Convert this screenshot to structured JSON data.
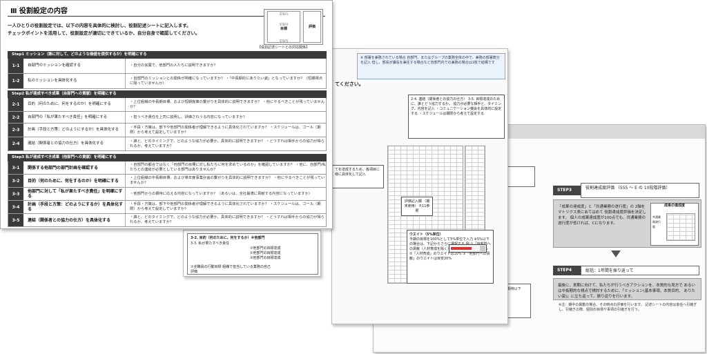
{
  "front": {
    "title": "Ⅲ 役割設定の内容",
    "intro1": "一人ひとりの役割設定では、以下の内容を具体的に検討し、役割記述シートに記入します。",
    "intro2": "チェックポイントを活用して、役割設定が適切にできているか、自分自身で確認してください。",
    "thumb": {
      "top": "STEP1",
      "mid": "目標",
      "step2": "STEP2",
      "right": "評価",
      "bottom": "STEP5"
    },
    "sheet_ref": "【役割記述シートとの対応関係】",
    "steps": [
      {
        "head": "Step1 ミッション（誰に対して、どのような価値を提供するか）を明確にする",
        "rows": [
          {
            "num": "1-1",
            "label": "自部門のミッションを確認する",
            "check": "・自分の言葉で、他部門の人たちに説明できますか？",
            "h": 17
          },
          {
            "num": "1-2",
            "label": "私のミッションを具体化する",
            "check": "・自部門のミッションとの関係が明確になっていますか？ ・「中長期的にありたい姿」となっていますか？（短期視点に陥っていませんか）",
            "h": 19
          }
        ]
      },
      {
        "head": "Step2 私が達成すべき成果（自部門への貢献）を明確にする",
        "rows": [
          {
            "num": "2-1",
            "label": "目的（何のために、何をするのか）を明確にする",
            "check": "・上位組織の中長期目標、および短期施策の繋がりを具体的に説明できますか？ ・他にやるべきことが残っていませんか？",
            "h": 20
          },
          {
            "num": "2-2",
            "label": "自部門の「私が果たすべき責任」を明確にする",
            "check": "・担うべき責任を上司に説明し、評価されうる内容になっていますか？",
            "h": 17
          },
          {
            "num": "2-3",
            "label": "計画（手段と方策：どのようにするか）を具体化する",
            "check": "・手段・方策は、部下や他部門の関係者が理解できるように具体化されていますか？ ・スケジュールは、ゴール（期限）から考えて設定していますか？",
            "h": 20
          },
          {
            "num": "2-4",
            "label": "連結（関係者との協力の仕方）を具体化する",
            "check": "・誰と、どのタイミングで、どのような協力が必要か、具体的に説明できますか？ ・どうすれば相手からの協力が得られるか、考えていますか？",
            "h": 19
          }
        ]
      },
      {
        "head": "Step3 私が達成すべき成果（他部門への貢献）を明確にする",
        "rows": [
          {
            "num": "3-1",
            "label": "関係する他部門の部門計画を確認する",
            "check": "・自部門の都合ではなく「他部門の目標に対し私たちに何を求めているのか」を確認していますか？ ・他に、自部門/私たちとの連結が必要としている部門はありませんか？",
            "h": 19,
            "bold": true
          },
          {
            "num": "3-2",
            "label": "目的（何のために、何をするのか）を明確にする",
            "check": "・上位組織の中長期目標、および単年度事業計画の繋がりを具体的に説明できますか？ ・他にやるべきことが残っていませんか？",
            "h": 19,
            "bold": true
          },
          {
            "num": "3-3",
            "label": "他部門に対して「私が果たすべき責任」を明確にする",
            "check": "・他部門からの期待に応える内容になっていますか？（あるいは、全社最適に貢献する内容になっていますか）",
            "h": 19,
            "bold": true
          },
          {
            "num": "3-4",
            "label": "計画（手段と方策：どのようにするか）を具体化する",
            "check": "・手段・方策は、部下や他部門の関係者が理解できるように具体化されていますか？ ・スケジュールは、ゴール（期限）から考えて設定していますか？",
            "h": 19,
            "bold": true
          },
          {
            "num": "3-5",
            "label": "連結（関係者との協力の仕方）を具体化する",
            "check": "・誰と、どのタイミングで、どのような協力が必要か、具体的に説明できますか？ ・どうすれば相手からの協力が得られるか、考えていますか？",
            "h": 19,
            "bold": true
          }
        ]
      }
    ]
  },
  "mid": {
    "bluebox": "※ 部署を兼務されている場合 自部門、またはグループの業務全体の中で、兼務の部署数分を記入 但し、部長が課長を兼任する場合など自部門内での兼務の場合は1枚で結構です",
    "headline": "てください。",
    "callout_top": "2-4. 連結（関係者との協力の仕方） 3-5. 目標達成のために、誰とどう協力するか。 協力が必要な相手と、タイミング、内容を記入 ・コミュニケーション機会を具体的に設定する ・スケジュールは期限から考えて設定する",
    "callout_left": "てを達成するため、各項目に 様に具体化して記入",
    "callout_mid": "評価記入欄 （期末使用） P.11参照",
    "weight_title": "ウエイト（5%単位）",
    "weight_body": "今期の目標を100%として5%単位で入力 ※5%以下の場合は、下記からさらに選択する 例 ①「自部門への貢献（人材育成を除く）」のウエイトは目安70% ②「人材育成」のウエイトは10% ③「他部門への貢献」のウエイトは目安20%"
  },
  "left": {
    "row1": "3-2. 目的（何のために、何をするか）※他部門",
    "row2": "3-3. 私が果たすべき責任",
    "opts": [
      "①他部門の目標達成",
      "②他部門の目標達成",
      "③他部門の目標達成"
    ],
    "foot": "①全職員の行動目標 組織で担当している業務の自己評価"
  },
  "right": {
    "step3_label": "STEP3",
    "step3_desc": "役割達成度評価 （555 ～ E の 10段階評価）",
    "step3_box": "「成果の達成度」と「共通業務の遂行度」の 2軸をマトリクス表にあてはめて 役割達成度評価を決定します。 個人の成果達成度が100点でも、共通業務の 遂行度が低ければ、Cになります。",
    "matrix_title": "成果の達成度",
    "matrix_axis": "共通業務遂行度",
    "step4_label": "STEP4",
    "step4_desc": "総括：1年間を振り返って",
    "step4_box": "最後に、来期に向けて、私たちが行うべきアクションを、本質的な見方で あるいは中長期的な視点で検討するために、「ミッション(基本事項、本質目的、 ありたい姿)」に立ち返って、振り返りを行います。",
    "footnote": "※注：期中の異動の場合、その時点の評価を行います。 記述シートの内容は後任へ引継ぎし、引継ぎの際、個別の目標や事項の引継ぎを行う。",
    "bottom_left": "共通業務の遂行度について、3段階で評価 〇：期待以上の成果 △：期待通り ×：期待以下",
    "bottom_note": "※「他部門」は組織運営(の)参照、P.11参照"
  }
}
